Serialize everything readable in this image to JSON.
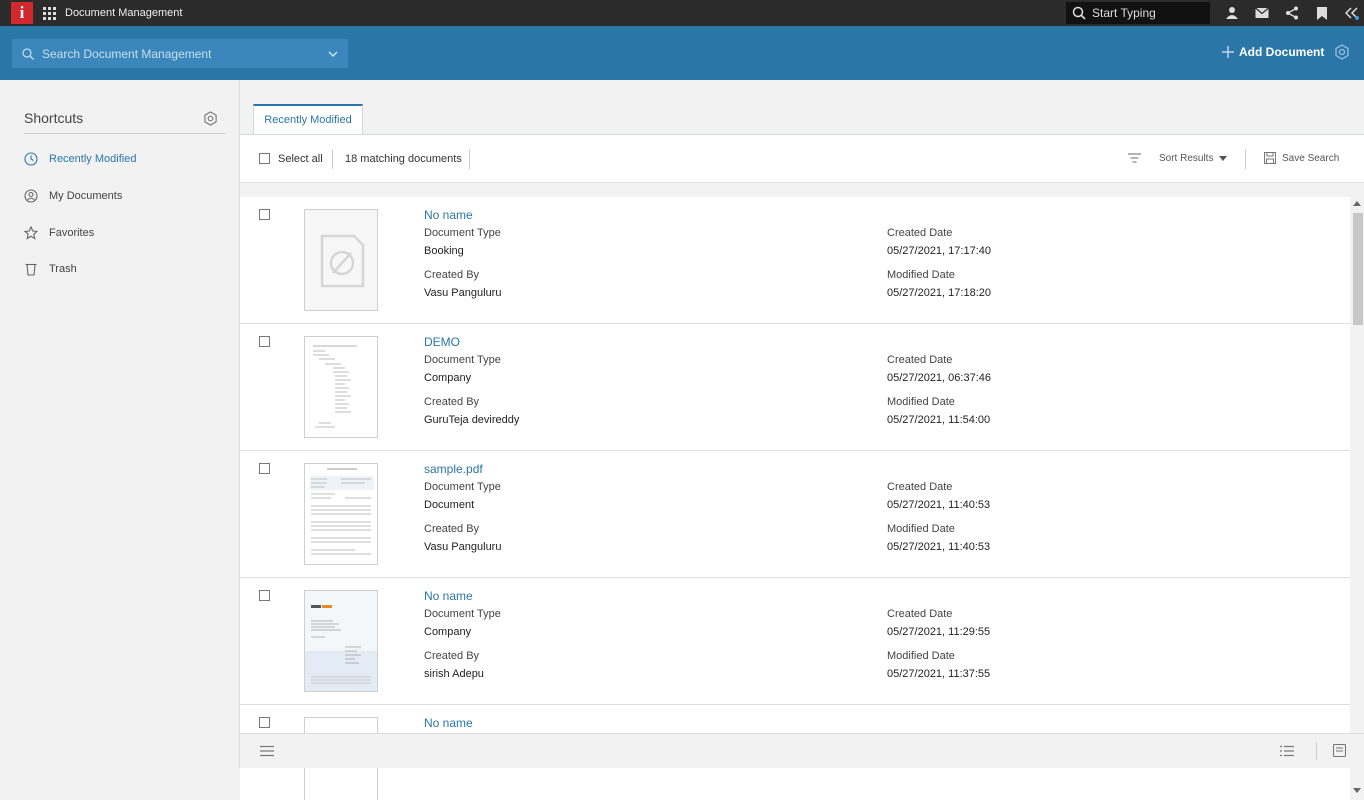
{
  "topbar": {
    "logo_letter": "i",
    "app_title": "Document Management",
    "search_placeholder": "Start Typing"
  },
  "header": {
    "search_placeholder": "Search Document Management",
    "add_document_label": "Add Document"
  },
  "sidebar": {
    "title": "Shortcuts",
    "items": [
      {
        "label": "Recently Modified",
        "icon": "clock-icon",
        "active": true
      },
      {
        "label": "My Documents",
        "icon": "user-circle-icon",
        "active": false
      },
      {
        "label": "Favorites",
        "icon": "star-icon",
        "active": false
      },
      {
        "label": "Trash",
        "icon": "trash-icon",
        "active": false
      }
    ]
  },
  "tabs": [
    {
      "label": "Recently Modified"
    }
  ],
  "toolbar": {
    "select_all_label": "Select all",
    "matching_count": "18 matching documents",
    "sort_label": "Sort Results",
    "save_search_label": "Save Search"
  },
  "field_labels": {
    "document_type": "Document Type",
    "created_by": "Created By",
    "created_date": "Created Date",
    "modified_date": "Modified Date"
  },
  "documents": [
    {
      "name": "No name",
      "document_type": "Booking",
      "created_by": "Vasu Panguluru",
      "created_date": "05/27/2021, 17:17:40",
      "modified_date": "05/27/2021, 17:18:20",
      "thumbnail": "no-preview-icon"
    },
    {
      "name": "DEMO",
      "document_type": "Company",
      "created_by": "GuruTeja devireddy",
      "created_date": "05/27/2021, 06:37:46",
      "modified_date": "05/27/2021, 11:54:00",
      "thumbnail": "text-document"
    },
    {
      "name": "sample.pdf",
      "document_type": "Document",
      "created_by": "Vasu Panguluru",
      "created_date": "05/27/2021, 11:40:53",
      "modified_date": "05/27/2021, 11:40:53",
      "thumbnail": "form-document"
    },
    {
      "name": "No name",
      "document_type": "Company",
      "created_by": "sirish Adepu",
      "created_date": "05/27/2021, 11:29:55",
      "modified_date": "05/27/2021, 11:37:55",
      "thumbnail": "letter-document"
    },
    {
      "name": "No name",
      "document_type": "",
      "created_by": "",
      "created_date": "",
      "modified_date": "",
      "thumbnail": "partial"
    }
  ],
  "colors": {
    "topbar": "#2b2b2b",
    "accent": "#2a76a9",
    "logo": "#d0282e"
  }
}
